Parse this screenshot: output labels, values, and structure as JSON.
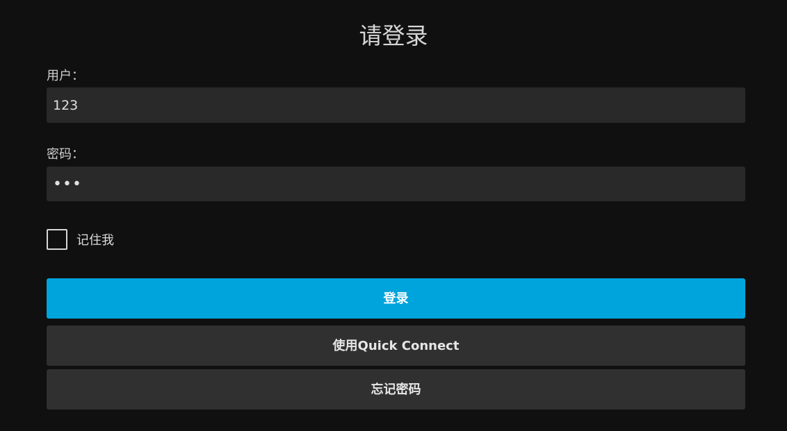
{
  "page": {
    "title": "请登录"
  },
  "form": {
    "username_label": "用户：",
    "username_value": "123",
    "password_label": "密码：",
    "password_value": "123",
    "remember_label": "记住我",
    "remember_checked": false
  },
  "buttons": {
    "login": "登录",
    "quick_connect": "使用Quick Connect",
    "forgot_password": "忘记密码"
  },
  "colors": {
    "background": "#101010",
    "input_background": "#292929",
    "primary_button": "#00a4dc",
    "secondary_button": "#303030"
  }
}
